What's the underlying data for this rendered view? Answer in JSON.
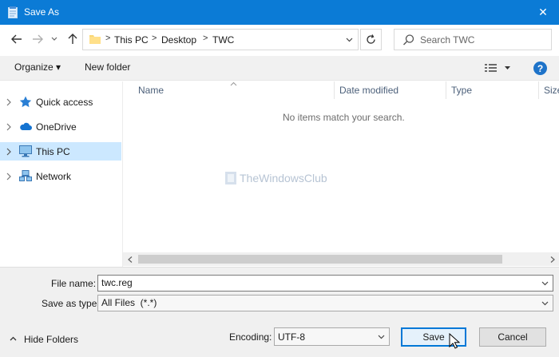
{
  "window": {
    "title": "Save As",
    "close_label": "✕"
  },
  "breadcrumb": [
    "This PC",
    "Desktop",
    "TWC"
  ],
  "search": {
    "placeholder": "Search TWC"
  },
  "toolbar": {
    "organize_label": "Organize ▾",
    "new_folder_label": "New folder",
    "help_label": "?"
  },
  "nav": {
    "items": [
      {
        "label": "Quick access",
        "icon": "star-icon"
      },
      {
        "label": "OneDrive",
        "icon": "cloud-icon"
      },
      {
        "label": "This PC",
        "icon": "computer-icon",
        "selected": true
      },
      {
        "label": "Network",
        "icon": "network-icon"
      }
    ]
  },
  "columns": [
    "Name",
    "Date modified",
    "Type",
    "Size"
  ],
  "empty_message": "No items match your search.",
  "watermark": "TheWindowsClub",
  "form": {
    "file_name_label": "File name:",
    "file_name_value": "twc.reg",
    "save_as_type_label": "Save as type:",
    "save_as_type_value": "All Files  (*.*)",
    "encoding_label": "Encoding:",
    "encoding_value": "UTF-8"
  },
  "buttons": {
    "hide_folders_label": "Hide Folders",
    "save_label": "Save",
    "cancel_label": "Cancel"
  },
  "colors": {
    "titlebar": "#0b7bd6",
    "selection": "#cce8ff",
    "accent": "#0078d7"
  }
}
